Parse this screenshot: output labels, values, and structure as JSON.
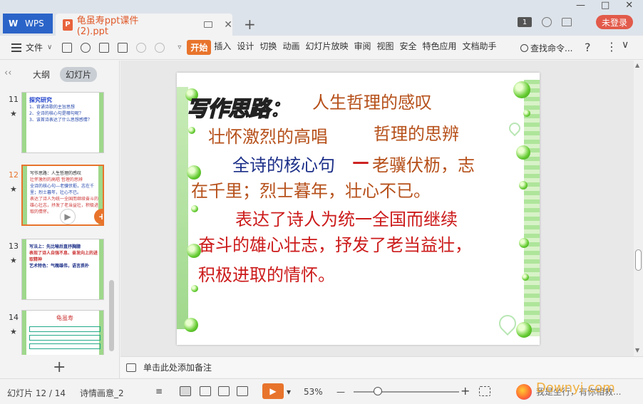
{
  "titlebar": {
    "wps_label": "WPS",
    "doc_title": "龟虽寿ppt课件 (2).ppt",
    "doc_icon_letter": "P",
    "new_tab": "+",
    "badge": "1",
    "login_label": "未登录",
    "win_min": "—",
    "win_max": "□",
    "win_close": "✕"
  },
  "menubar": {
    "file_label": "文件",
    "items": [
      "开始",
      "插入",
      "设计",
      "切换",
      "动画",
      "幻灯片放映",
      "审阅",
      "视图",
      "安全",
      "特色应用",
      "文档助手"
    ],
    "active_item": "开始",
    "search_label": "查找命令...",
    "help": "?",
    "more": "⋮",
    "collapse": "∨"
  },
  "leftpanel": {
    "tab_outline": "大纲",
    "tab_slides": "幻灯片",
    "collapse": "‹‹",
    "thumbs": [
      {
        "num": "11",
        "star": "★",
        "lines": [
          "探究研究",
          "1、背诵诗歌的主旨思想",
          "2、全诗的核心句是哪句呢？",
          "3、该首诗表达了什么思想感情？"
        ]
      },
      {
        "num": "12",
        "star": "★",
        "lines": [
          "写作思路：人生哲理的感叹",
          "壮怀激烈的高唱  哲理的思辨",
          "全诗的核心句—老骥伏枥，志在千里；烈士暮年，壮心不已。",
          "表达了诗人为统一全国而继续奋斗的雄心壮志，抒发了老当益壮，积极进取的情怀。"
        ]
      },
      {
        "num": "13",
        "star": "★",
        "lines": [
          "写法上：先比喻后直抒胸臆",
          "表现了诗人自强不息、奋发向上的进取精神",
          "艺术特色：气魄雄伟，语言质朴"
        ]
      },
      {
        "num": "14",
        "star": "★",
        "lines": [
          "龟虽寿"
        ]
      }
    ],
    "add_slide": "+"
  },
  "slide": {
    "heading": "写作思路：",
    "line1_tail": "人生哲理的感叹",
    "line2a": "壮怀激烈的高唱",
    "line2b": "哲理的思辨",
    "line3a": "全诗的核心句",
    "line3_dash": "—",
    "line3b": "老骥伏枥，志",
    "line4": "在千里；烈士暮年，壮心不已。",
    "line5": "表达了诗人为统一全国而继续",
    "line6": "奋斗的雄心壮志，抒发了老当益壮，",
    "line7": "积极进取的情怀。"
  },
  "notes": {
    "placeholder": "单击此处添加备注"
  },
  "statusbar": {
    "slide_counter": "幻灯片 12 / 14",
    "theme_name": "诗情画意_2",
    "zoom": "53%",
    "zoom_minus": "—",
    "zoom_plus": "+",
    "watermark_text": "我是坐行，有你相救...",
    "watermark_brand": "Downyi.com"
  },
  "colors": {
    "accent": "#e8742c",
    "wps_blue": "#2b64c8",
    "login_red": "#e25a4a"
  }
}
